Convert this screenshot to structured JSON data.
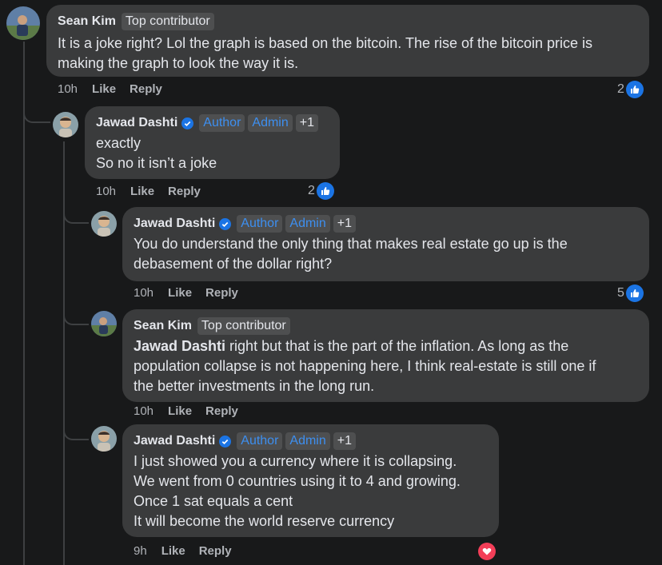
{
  "comments": [
    {
      "author": "Sean Kim",
      "badges": [
        "Top contributor"
      ],
      "lines": [
        "It is a joke right? Lol the graph is based on the bitcoin. The rise of the bitcoin price is",
        "making the graph to look the way it is."
      ],
      "time": "10h",
      "like": "Like",
      "reply": "Reply",
      "reaction_count": "2",
      "reaction_type": "like-icon"
    },
    {
      "author": "Jawad Dashti",
      "badges": [
        "Author",
        "Admin",
        "+1"
      ],
      "lines": [
        "exactly",
        "So no it isn’t a joke"
      ],
      "time": "10h",
      "like": "Like",
      "reply": "Reply",
      "reaction_count": "2",
      "reaction_type": "like-icon"
    },
    {
      "author": "Jawad Dashti",
      "badges": [
        "Author",
        "Admin",
        "+1"
      ],
      "lines": [
        "You do understand the only thing that makes real estate go up is the",
        "debasement of the dollar right?"
      ],
      "time": "10h",
      "like": "Like",
      "reply": "Reply",
      "reaction_count": "5",
      "reaction_type": "like-icon"
    },
    {
      "author": "Sean Kim",
      "badges": [
        "Top contributor"
      ],
      "mention": "Jawad Dashti",
      "lines": [
        " right but that is the part of the inflation. As long as the",
        "population collapse is not happening here, I think real-estate is still one if",
        "the better investments in the long run."
      ],
      "time": "10h",
      "like": "Like",
      "reply": "Reply"
    },
    {
      "author": "Jawad Dashti",
      "badges": [
        "Author",
        "Admin",
        "+1"
      ],
      "lines": [
        "I just showed you a currency where it is collapsing.",
        "We went from 0 countries using it to 4 and growing.",
        "Once 1 sat equals a cent",
        "It will become the world reserve currency"
      ],
      "time": "9h",
      "like": "Like",
      "reply": "Reply",
      "reaction_type": "heart-icon"
    }
  ],
  "colors": {
    "background": "#18191a",
    "bubble": "#3a3b3c",
    "badge_bg": "#4e4f50",
    "badge_blue": "#3d8ff0",
    "like_blue": "#1b74e4",
    "heart_red": "#f33e58",
    "secondary_text": "#b0b3b8"
  }
}
